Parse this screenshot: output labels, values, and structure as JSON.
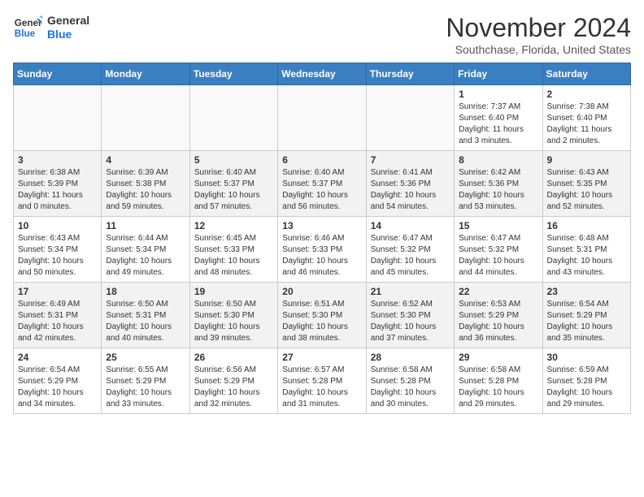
{
  "header": {
    "logo_line1": "General",
    "logo_line2": "Blue",
    "month": "November 2024",
    "location": "Southchase, Florida, United States"
  },
  "weekdays": [
    "Sunday",
    "Monday",
    "Tuesday",
    "Wednesday",
    "Thursday",
    "Friday",
    "Saturday"
  ],
  "weeks": [
    [
      {
        "day": "",
        "info": ""
      },
      {
        "day": "",
        "info": ""
      },
      {
        "day": "",
        "info": ""
      },
      {
        "day": "",
        "info": ""
      },
      {
        "day": "",
        "info": ""
      },
      {
        "day": "1",
        "info": "Sunrise: 7:37 AM\nSunset: 6:40 PM\nDaylight: 11 hours and 3 minutes."
      },
      {
        "day": "2",
        "info": "Sunrise: 7:38 AM\nSunset: 6:40 PM\nDaylight: 11 hours and 2 minutes."
      }
    ],
    [
      {
        "day": "3",
        "info": "Sunrise: 6:38 AM\nSunset: 5:39 PM\nDaylight: 11 hours and 0 minutes."
      },
      {
        "day": "4",
        "info": "Sunrise: 6:39 AM\nSunset: 5:38 PM\nDaylight: 10 hours and 59 minutes."
      },
      {
        "day": "5",
        "info": "Sunrise: 6:40 AM\nSunset: 5:37 PM\nDaylight: 10 hours and 57 minutes."
      },
      {
        "day": "6",
        "info": "Sunrise: 6:40 AM\nSunset: 5:37 PM\nDaylight: 10 hours and 56 minutes."
      },
      {
        "day": "7",
        "info": "Sunrise: 6:41 AM\nSunset: 5:36 PM\nDaylight: 10 hours and 54 minutes."
      },
      {
        "day": "8",
        "info": "Sunrise: 6:42 AM\nSunset: 5:36 PM\nDaylight: 10 hours and 53 minutes."
      },
      {
        "day": "9",
        "info": "Sunrise: 6:43 AM\nSunset: 5:35 PM\nDaylight: 10 hours and 52 minutes."
      }
    ],
    [
      {
        "day": "10",
        "info": "Sunrise: 6:43 AM\nSunset: 5:34 PM\nDaylight: 10 hours and 50 minutes."
      },
      {
        "day": "11",
        "info": "Sunrise: 6:44 AM\nSunset: 5:34 PM\nDaylight: 10 hours and 49 minutes."
      },
      {
        "day": "12",
        "info": "Sunrise: 6:45 AM\nSunset: 5:33 PM\nDaylight: 10 hours and 48 minutes."
      },
      {
        "day": "13",
        "info": "Sunrise: 6:46 AM\nSunset: 5:33 PM\nDaylight: 10 hours and 46 minutes."
      },
      {
        "day": "14",
        "info": "Sunrise: 6:47 AM\nSunset: 5:32 PM\nDaylight: 10 hours and 45 minutes."
      },
      {
        "day": "15",
        "info": "Sunrise: 6:47 AM\nSunset: 5:32 PM\nDaylight: 10 hours and 44 minutes."
      },
      {
        "day": "16",
        "info": "Sunrise: 6:48 AM\nSunset: 5:31 PM\nDaylight: 10 hours and 43 minutes."
      }
    ],
    [
      {
        "day": "17",
        "info": "Sunrise: 6:49 AM\nSunset: 5:31 PM\nDaylight: 10 hours and 42 minutes."
      },
      {
        "day": "18",
        "info": "Sunrise: 6:50 AM\nSunset: 5:31 PM\nDaylight: 10 hours and 40 minutes."
      },
      {
        "day": "19",
        "info": "Sunrise: 6:50 AM\nSunset: 5:30 PM\nDaylight: 10 hours and 39 minutes."
      },
      {
        "day": "20",
        "info": "Sunrise: 6:51 AM\nSunset: 5:30 PM\nDaylight: 10 hours and 38 minutes."
      },
      {
        "day": "21",
        "info": "Sunrise: 6:52 AM\nSunset: 5:30 PM\nDaylight: 10 hours and 37 minutes."
      },
      {
        "day": "22",
        "info": "Sunrise: 6:53 AM\nSunset: 5:29 PM\nDaylight: 10 hours and 36 minutes."
      },
      {
        "day": "23",
        "info": "Sunrise: 6:54 AM\nSunset: 5:29 PM\nDaylight: 10 hours and 35 minutes."
      }
    ],
    [
      {
        "day": "24",
        "info": "Sunrise: 6:54 AM\nSunset: 5:29 PM\nDaylight: 10 hours and 34 minutes."
      },
      {
        "day": "25",
        "info": "Sunrise: 6:55 AM\nSunset: 5:29 PM\nDaylight: 10 hours and 33 minutes."
      },
      {
        "day": "26",
        "info": "Sunrise: 6:56 AM\nSunset: 5:29 PM\nDaylight: 10 hours and 32 minutes."
      },
      {
        "day": "27",
        "info": "Sunrise: 6:57 AM\nSunset: 5:28 PM\nDaylight: 10 hours and 31 minutes."
      },
      {
        "day": "28",
        "info": "Sunrise: 6:58 AM\nSunset: 5:28 PM\nDaylight: 10 hours and 30 minutes."
      },
      {
        "day": "29",
        "info": "Sunrise: 6:58 AM\nSunset: 5:28 PM\nDaylight: 10 hours and 29 minutes."
      },
      {
        "day": "30",
        "info": "Sunrise: 6:59 AM\nSunset: 5:28 PM\nDaylight: 10 hours and 29 minutes."
      }
    ]
  ]
}
